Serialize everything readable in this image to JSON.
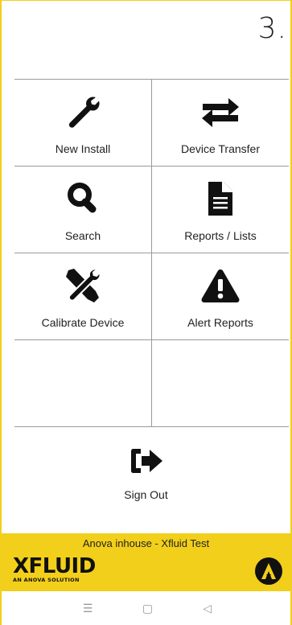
{
  "header": {
    "step_number": "3."
  },
  "menu": {
    "new_install": "New Install",
    "device_transfer": "Device Transfer",
    "search": "Search",
    "reports_lists": "Reports / Lists",
    "calibrate_device": "Calibrate Device",
    "alert_reports": "Alert Reports"
  },
  "signout": {
    "label": "Sign Out"
  },
  "footer": {
    "org_name": "Anova inhouse - Xfluid Test",
    "brand_logo": "XFLUID",
    "brand_tagline": "AN ANOVA SOLUTION",
    "accent_color": "#f2cf1a"
  },
  "navbar": {
    "menu_icon": "☰",
    "home_icon": "▢",
    "back_icon": "◁"
  }
}
